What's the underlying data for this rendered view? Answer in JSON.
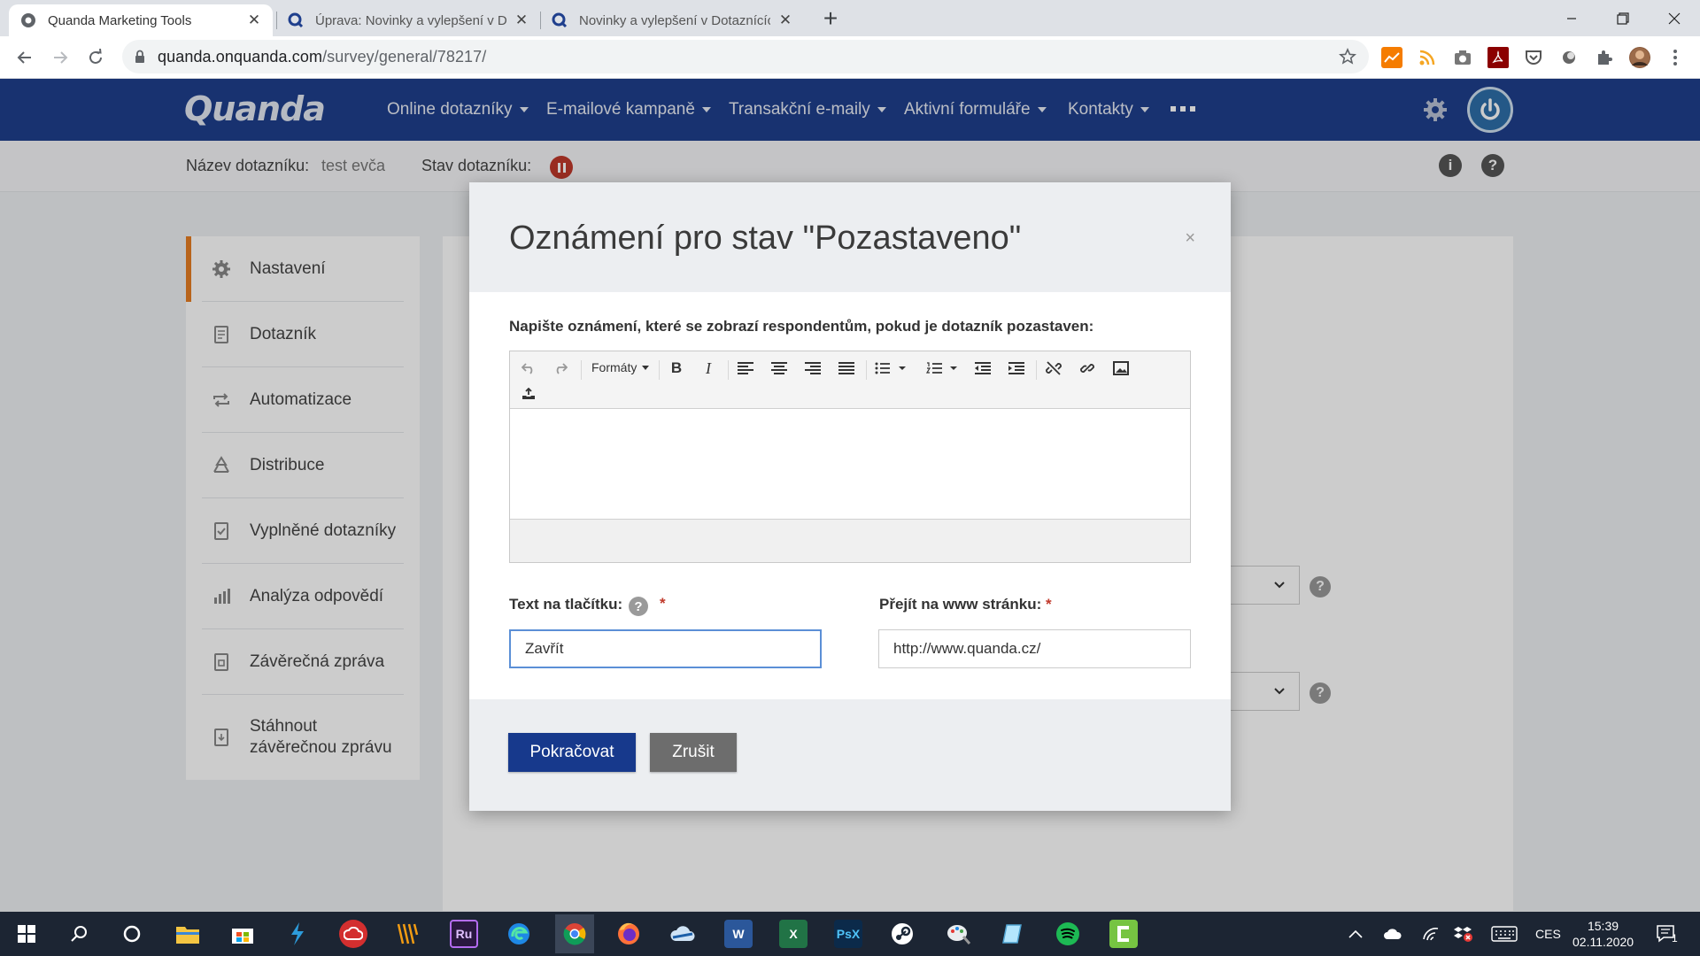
{
  "browser": {
    "tabs": [
      {
        "title": "Quanda Marketing Tools",
        "active": true
      },
      {
        "title": "Úprava: Novinky a vylepšení v Dotazníc",
        "active": false
      },
      {
        "title": "Novinky a vylepšení v Dotaznících",
        "active": false
      }
    ],
    "url_host": "quanda.onquanda.com",
    "url_path": "/survey/general/78217/",
    "window_controls": [
      "minimize",
      "restore",
      "close"
    ]
  },
  "app": {
    "logo": "Quanda",
    "nav": [
      {
        "label": "Online dotazníky"
      },
      {
        "label": "E-mailové kampaně"
      },
      {
        "label": "Transakční e-maily"
      },
      {
        "label": "Aktivní formuláře"
      },
      {
        "label": "Kontakty"
      }
    ],
    "survey_name_label": "Název dotazníku:",
    "survey_name": "test evča",
    "survey_status_label": "Stav dotazníku:",
    "info_icon": "i",
    "help_icon": "?"
  },
  "sidebar": {
    "items": [
      {
        "label": "Nastavení",
        "icon": "gear-icon",
        "active": true
      },
      {
        "label": "Dotazník",
        "icon": "document-icon"
      },
      {
        "label": "Automatizace",
        "icon": "repeat-icon"
      },
      {
        "label": "Distribuce",
        "icon": "recycle-icon"
      },
      {
        "label": "Vyplněné dotazníky",
        "icon": "checked-file-icon"
      },
      {
        "label": "Analýza odpovědí",
        "icon": "bar-chart-icon"
      },
      {
        "label": "Závěrečná zpráva",
        "icon": "report-icon"
      },
      {
        "label": "Stáhnout závěrečnou zprávu",
        "icon": "download-report-icon"
      }
    ]
  },
  "modal": {
    "title": "Oznámení pro stav \"Pozastaveno\"",
    "close": "×",
    "editor_label": "Napište oznámení, které se zobrazí respondentům, pokud je dotazník pozastaven:",
    "toolbar": {
      "formats": "Formáty"
    },
    "editor_content": "",
    "button_text_label": "Text na tlačítku:",
    "button_text_value": "Zavřít",
    "url_label": "Přejít na www stránku:",
    "url_value": "http://www.quanda.cz/",
    "required_mark": "*",
    "help": "?",
    "continue_button": "Pokračovat",
    "cancel_button": "Zrušit"
  },
  "taskbar": {
    "language": "CES",
    "time": "15:39",
    "date": "02.11.2020",
    "notification_count": "1"
  },
  "colors": {
    "nav_bg": "#1f3f8d",
    "sidebar_accent": "#e67e22",
    "primary_button": "#17398c",
    "secondary_button": "#6d6d6d",
    "pause_badge": "#c0392b"
  }
}
